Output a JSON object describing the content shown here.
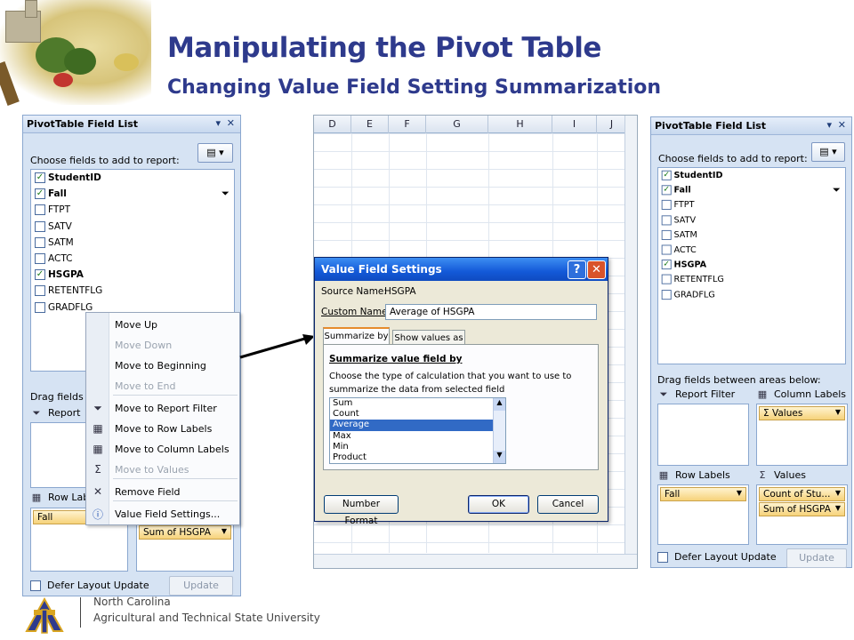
{
  "slide": {
    "title": "Manipulating the Pivot Table",
    "subtitle": "Changing Value Field Setting Summarization",
    "footer_line1": "North Carolina",
    "footer_line2": "Agricultural and Technical State University"
  },
  "left_panel": {
    "title": "PivotTable Field List",
    "choose_label": "Choose fields to add to report:",
    "fields": [
      {
        "name": "StudentID",
        "checked": true
      },
      {
        "name": "Fall",
        "checked": true
      },
      {
        "name": "FTPT",
        "checked": false
      },
      {
        "name": "SATV",
        "checked": false
      },
      {
        "name": "SATM",
        "checked": false
      },
      {
        "name": "ACTC",
        "checked": false
      },
      {
        "name": "HSGPA",
        "checked": true
      },
      {
        "name": "RETENTFLG",
        "checked": false
      },
      {
        "name": "GRADFLG",
        "checked": false
      }
    ],
    "drag_label": "Drag fields be",
    "report_filter_label": "Report",
    "row_labels_label": "Row Lab",
    "row_chip": "Fall",
    "value_chip": "Sum of HSGPA",
    "defer_label": "Defer Layout Update",
    "update_label": "Update"
  },
  "context_menu": {
    "items": [
      {
        "label": "Move Up",
        "disabled": false,
        "icon": ""
      },
      {
        "label": "Move Down",
        "disabled": true,
        "icon": ""
      },
      {
        "label": "Move to Beginning",
        "disabled": false,
        "icon": ""
      },
      {
        "label": "Move to End",
        "disabled": true,
        "icon": ""
      },
      {
        "label": "Move to Report Filter",
        "disabled": false,
        "icon": "filter-icon"
      },
      {
        "label": "Move to Row Labels",
        "disabled": false,
        "icon": "row-labels-icon"
      },
      {
        "label": "Move to Column Labels",
        "disabled": false,
        "icon": "column-labels-icon"
      },
      {
        "label": "Move to Values",
        "disabled": true,
        "icon": "sigma-icon"
      },
      {
        "label": "Remove Field",
        "disabled": false,
        "icon": "remove-x-icon"
      },
      {
        "label": "Value Field Settings...",
        "disabled": false,
        "icon": "info-settings-icon"
      }
    ]
  },
  "sheet": {
    "columns": [
      "D",
      "E",
      "F",
      "G",
      "H",
      "I",
      "J"
    ]
  },
  "dialog": {
    "title": "Value Field Settings",
    "help_btn": "?",
    "close_btn": "✕",
    "source_name_label": "Source Name:",
    "source_name_value": "HSGPA",
    "custom_name_label": "Custom Name:",
    "custom_name_value": "Average of HSGPA",
    "tab_summarize": "Summarize by",
    "tab_show_values": "Show values as",
    "section_title": "Summarize value field by",
    "description": "Choose the type of calculation that you want to use to summarize the data from selected field",
    "options": [
      "Sum",
      "Count",
      "Average",
      "Max",
      "Min",
      "Product"
    ],
    "selected_option": "Average",
    "number_format_btn": "Number Format",
    "ok_btn": "OK",
    "cancel_btn": "Cancel"
  },
  "right_panel": {
    "title": "PivotTable Field List",
    "choose_label": "Choose fields to add to report:",
    "fields": [
      {
        "name": "StudentID",
        "checked": true
      },
      {
        "name": "Fall",
        "checked": true
      },
      {
        "name": "FTPT",
        "checked": false
      },
      {
        "name": "SATV",
        "checked": false
      },
      {
        "name": "SATM",
        "checked": false
      },
      {
        "name": "ACTC",
        "checked": false
      },
      {
        "name": "HSGPA",
        "checked": true
      },
      {
        "name": "RETENTFLG",
        "checked": false
      },
      {
        "name": "GRADFLG",
        "checked": false
      }
    ],
    "drag_label": "Drag fields between areas below:",
    "report_filter_label": "Report Filter",
    "column_labels_label": "Column Labels",
    "row_labels_label": "Row Labels",
    "values_label": "Values",
    "column_chip": "Values",
    "row_chip": "Fall",
    "value_chips": [
      "Count of Stu...",
      "Sum of HSGPA"
    ],
    "defer_label": "Defer Layout Update",
    "update_label": "Update"
  }
}
